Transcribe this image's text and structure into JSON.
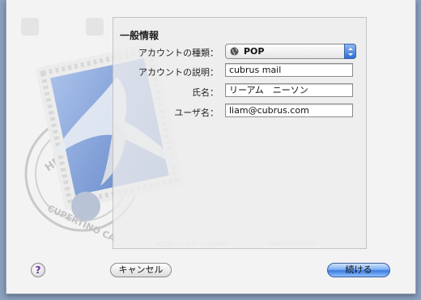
{
  "dialog": {
    "section_title": "一般情報",
    "fields": {
      "account_type": {
        "label": "アカウントの種類：",
        "value": "POP"
      },
      "account_description": {
        "label": "アカウントの説明：",
        "value": "cubrus mail"
      },
      "full_name": {
        "label": "氏名：",
        "value": "リーアム　ニーソン"
      },
      "user_name": {
        "label": "ユーザ名：",
        "value": "liam@cubrus.com"
      }
    },
    "buttons": {
      "help": "?",
      "cancel": "キャンセル",
      "continue": "続ける"
    }
  },
  "colors": {
    "desktop": "#8aa0bd",
    "accent": "#3b7be0",
    "help_glyph": "#6a2ea0"
  },
  "icons": {
    "stamp": "mail-stamp-icon",
    "globe": "globe-icon",
    "popup_arrows": "up-down-arrows-icon"
  }
}
